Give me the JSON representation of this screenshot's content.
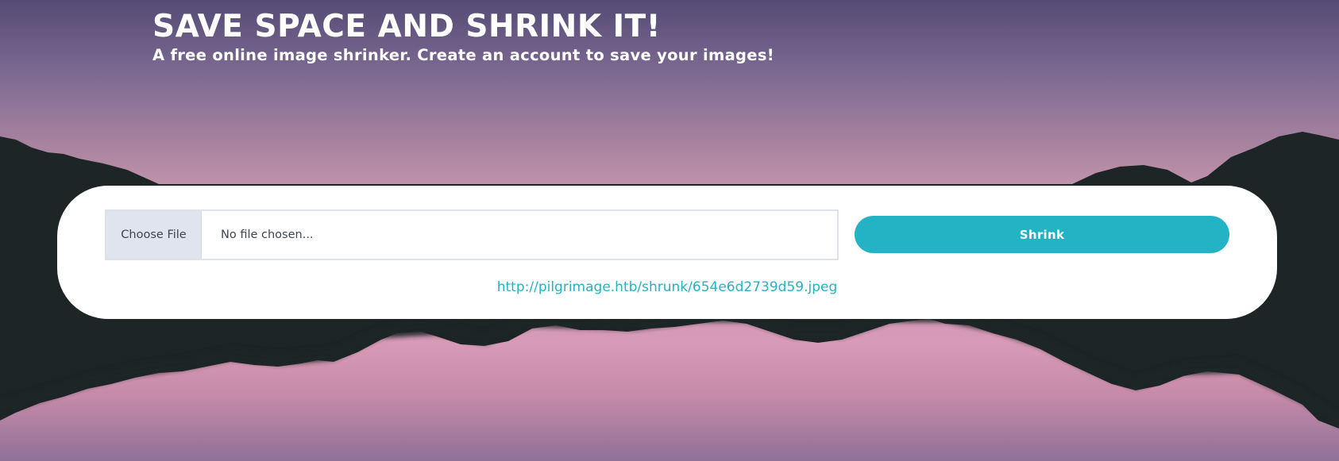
{
  "hero": {
    "title": "SAVE SPACE AND SHRINK IT!",
    "subtitle": "A free online image shrinker. Create an account to save your images!"
  },
  "upload": {
    "choose_file_label": "Choose File",
    "file_status": "No file chosen...",
    "shrink_label": "Shrink",
    "result_url": "http://pilgrimage.htb/shrunk/654e6d2739d59.jpeg"
  },
  "colors": {
    "accent": "#23b3c4",
    "mountain": "#1d2526",
    "sky_top": "#544b75",
    "sky_pink": "#c694ae"
  }
}
